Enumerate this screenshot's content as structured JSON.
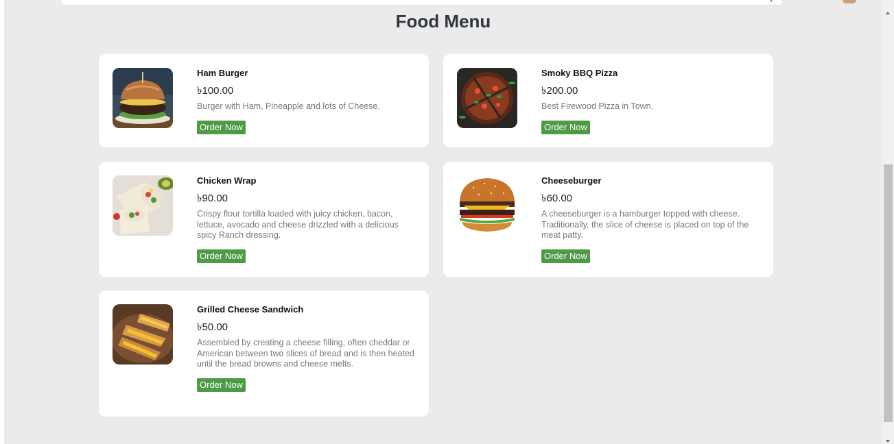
{
  "page": {
    "title": "Food Menu"
  },
  "menu": {
    "items": [
      {
        "name": "Ham Burger",
        "price": "৳100.00",
        "description": "Burger with Ham, Pineapple and lots of Cheese.",
        "button": "Order Now",
        "image": "ham-burger-photo"
      },
      {
        "name": "Smoky BBQ Pizza",
        "price": "৳200.00",
        "description": "Best Firewood Pizza in Town.",
        "button": "Order Now",
        "image": "bbq-pizza-photo"
      },
      {
        "name": "Chicken Wrap",
        "price": "৳90.00",
        "description": "Crispy flour tortilla loaded with juicy chicken, bacon, lettuce, avocado and cheese drizzled with a delicious spicy Ranch dressing.",
        "button": "Order Now",
        "image": "chicken-wrap-photo"
      },
      {
        "name": "Cheeseburger",
        "price": "৳60.00",
        "description": "A cheeseburger is a hamburger topped with cheese. Traditionally, the slice of cheese is placed on top of the meat patty.",
        "button": "Order Now",
        "image": "cheeseburger-photo"
      },
      {
        "name": "Grilled Cheese Sandwich",
        "price": "৳50.00",
        "description": "Assembled by creating a cheese filling, often cheddar or American between two slices of bread and is then heated until the bread browns and cheese melts.",
        "button": "Order Now",
        "image": "grilled-cheese-photo"
      }
    ]
  },
  "colors": {
    "background": "#ebebeb",
    "card": "#ffffff",
    "button": "#4f9a46",
    "title": "#2f3640",
    "description": "#7a7a7a"
  }
}
